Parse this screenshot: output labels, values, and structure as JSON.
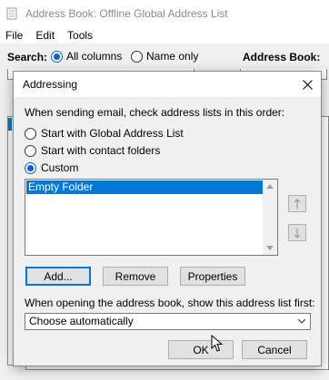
{
  "background_window": {
    "title": "Address Book: Offline Global Address List",
    "menu": [
      "File",
      "Edit",
      "Tools"
    ],
    "search_label": "Search:",
    "search_options": [
      {
        "label": "All columns",
        "selected": true
      },
      {
        "label": "Name only",
        "selected": false
      }
    ],
    "address_book_label": "Address Book:"
  },
  "dialog": {
    "title": "Addressing",
    "instruction": "When sending email, check address lists in this order:",
    "options": [
      {
        "label": "Start with Global Address List",
        "selected": false
      },
      {
        "label": "Start with contact folders",
        "selected": false
      },
      {
        "label": "Custom",
        "selected": true
      }
    ],
    "list_items": [
      "Empty Folder"
    ],
    "buttons": {
      "add": "Add...",
      "remove": "Remove",
      "properties": "Properties",
      "ok": "OK",
      "cancel": "Cancel"
    },
    "open_label": "When opening the address book, show this address list first:",
    "open_value": "Choose automatically"
  },
  "colors": {
    "accent": "#0078d7",
    "radio_selected": "#0b5fcc",
    "window_bg": "#f0f0f0"
  }
}
